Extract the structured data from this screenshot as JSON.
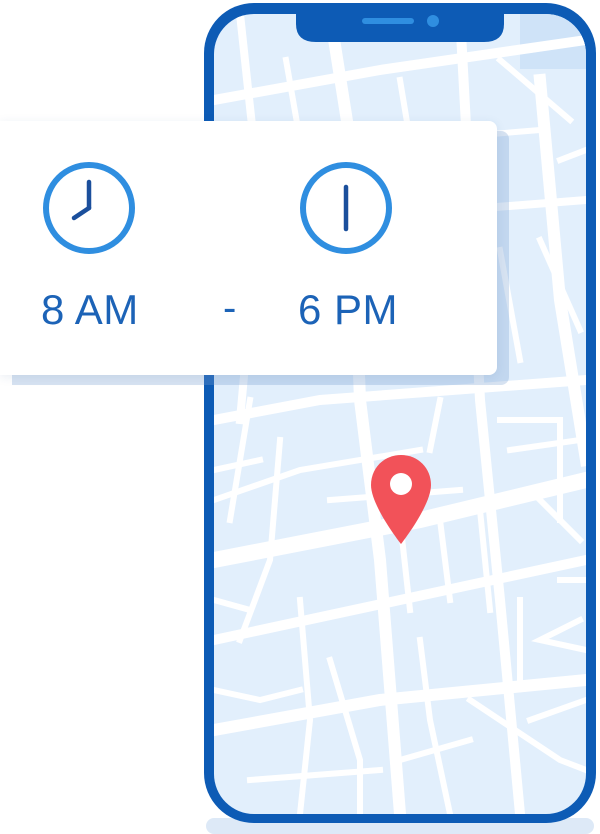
{
  "hours": {
    "open": "8 AM",
    "separator": "-",
    "close": "6 PM"
  },
  "icons": {
    "open_clock": "clock-icon",
    "close_clock": "clock-icon",
    "phone": "smartphone-icon",
    "map_pin": "location-pin-icon"
  },
  "colors": {
    "phone_frame": "#0d5bb5",
    "map_background": "#e2effc",
    "map_roads": "#ffffff",
    "clock_ring": "#2f8ee0",
    "clock_hands": "#1b4f9c",
    "text": "#1c63b7",
    "pin": "#f25259",
    "card": "#ffffff"
  }
}
